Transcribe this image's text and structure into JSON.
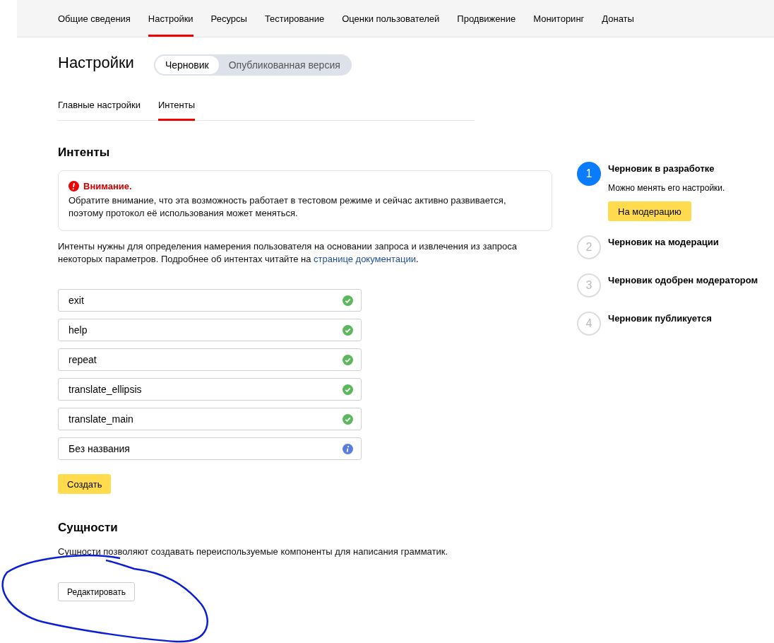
{
  "nav": {
    "items": [
      {
        "label": "Общие сведения",
        "selected": false
      },
      {
        "label": "Настройки",
        "selected": true
      },
      {
        "label": "Ресурсы",
        "selected": false
      },
      {
        "label": "Тестирование",
        "selected": false
      },
      {
        "label": "Оценки пользователей",
        "selected": false
      },
      {
        "label": "Продвижение",
        "selected": false
      },
      {
        "label": "Мониторинг",
        "selected": false
      },
      {
        "label": "Донаты",
        "selected": false
      }
    ]
  },
  "page_title": "Настройки",
  "version_switch": [
    {
      "label": "Черновик",
      "selected": true
    },
    {
      "label": "Опубликованная версия",
      "selected": false
    }
  ],
  "subtabs": [
    {
      "label": "Главные настройки",
      "selected": false
    },
    {
      "label": "Интенты",
      "selected": true
    }
  ],
  "intents_section": {
    "title": "Интенты",
    "warning": {
      "title": "Внимание.",
      "text": "Обратите внимание, что эта возможность работает в тестовом режиме и сейчас активно развивается, поэтому протокол её использования может меняться."
    },
    "description": "Интенты нужны для определения намерения пользователя на основании запроса и извлечения из запроса некоторых параметров. Подробнее об интентах читайте на ",
    "link": "странице документации",
    "after_link": ".",
    "intents": [
      {
        "name": "exit",
        "valid": true
      },
      {
        "name": "help",
        "valid": true
      },
      {
        "name": "repeat",
        "valid": true
      },
      {
        "name": "translate_ellipsis",
        "valid": true
      },
      {
        "name": "translate_main",
        "valid": true
      },
      {
        "name": "Без названия",
        "valid": false
      }
    ],
    "create_button": "Создать"
  },
  "entities_section": {
    "title": "Сущности",
    "text": "Сущности позволяют создавать переиспользуемые компоненты для написания грамматик.",
    "edit_button": "Редактировать"
  },
  "steps": [
    {
      "number": "1",
      "title": "Черновик в разработке",
      "active": true,
      "text": "Можно менять его настройки.",
      "button": "На модерацию"
    },
    {
      "number": "2",
      "title": "Черновик на модерации",
      "active": false
    },
    {
      "number": "3",
      "title": "Черновик одобрен модератором",
      "active": false
    },
    {
      "number": "4",
      "title": "Черновик публикуется",
      "active": false
    }
  ]
}
